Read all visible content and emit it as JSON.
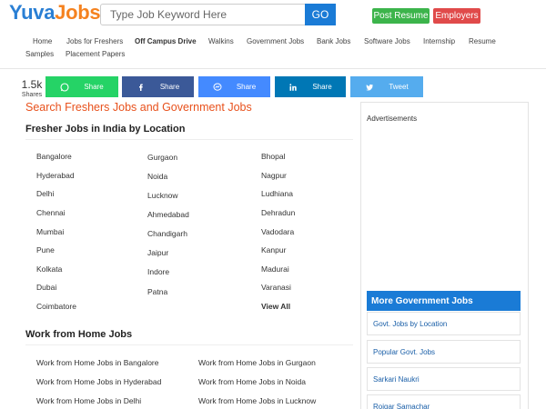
{
  "header": {
    "logo_part1": "Yuva",
    "logo_part2": "Jobs",
    "search_placeholder": "Type Job Keyword Here",
    "go_label": "GO",
    "post_resume_label": "Post Resume",
    "employers_label": "Employers"
  },
  "nav": {
    "items": [
      "Home",
      "Jobs for Freshers",
      "Off Campus Drive",
      "Walkins",
      "Government Jobs",
      "Bank Jobs",
      "Software Jobs",
      "Internship",
      "Resume",
      "Samples",
      "Placement Papers"
    ]
  },
  "share": {
    "count": "1.5k",
    "count_label": "Shares",
    "buttons": [
      {
        "label": "Share",
        "icon": "whatsapp-icon",
        "color": "#25d366"
      },
      {
        "label": "Share",
        "icon": "facebook-icon",
        "color": "#3b5998"
      },
      {
        "label": "Share",
        "icon": "messenger-icon",
        "color": "#448aff"
      },
      {
        "label": "Share",
        "icon": "linkedin-icon",
        "color": "#0077b5"
      },
      {
        "label": "Tweet",
        "icon": "twitter-icon",
        "color": "#55acee"
      }
    ]
  },
  "main": {
    "title": "Search Freshers Jobs and Government Jobs",
    "locations_heading": "Fresher Jobs in India by Location",
    "locations": {
      "col1": [
        "Bangalore",
        "Hyderabad",
        "Delhi",
        "Chennai",
        "Mumbai",
        "Pune",
        "Kolkata",
        "Dubai",
        "Coimbatore"
      ],
      "col2": [
        "Gurgaon",
        "Noida",
        "Lucknow",
        "Ahmedabad",
        "Chandigarh",
        "Jaipur",
        "Indore",
        "Patna"
      ],
      "col3": [
        "Bhopal",
        "Nagpur",
        "Ludhiana",
        "Dehradun",
        "Vadodara",
        "Kanpur",
        "Madurai",
        "Varanasi",
        "View All"
      ]
    },
    "wfh_heading": "Work from Home Jobs",
    "wfh": {
      "col1": [
        "Work from Home Jobs in Bangalore",
        "Work from Home Jobs in Hyderabad",
        "Work from Home Jobs in Delhi"
      ],
      "col2": [
        "Work from Home Jobs in Gurgaon",
        "Work from Home Jobs in Noida",
        "Work from Home Jobs in Lucknow"
      ]
    }
  },
  "sidebar": {
    "ads_label": "Advertisements",
    "gov_heading": "More Government Jobs",
    "gov_items": [
      "Govt. Jobs by Location",
      "Popular Govt. Jobs",
      "Sarkari Naukri",
      "Rojgar Samachar"
    ]
  },
  "colors": {
    "brand_blue": "#2a7fd4",
    "brand_orange": "#f5821f",
    "accent_red": "#e8511c",
    "go_blue": "#1a7bd6",
    "post_green": "#3cb44b",
    "employer_red": "#e04a4a"
  }
}
